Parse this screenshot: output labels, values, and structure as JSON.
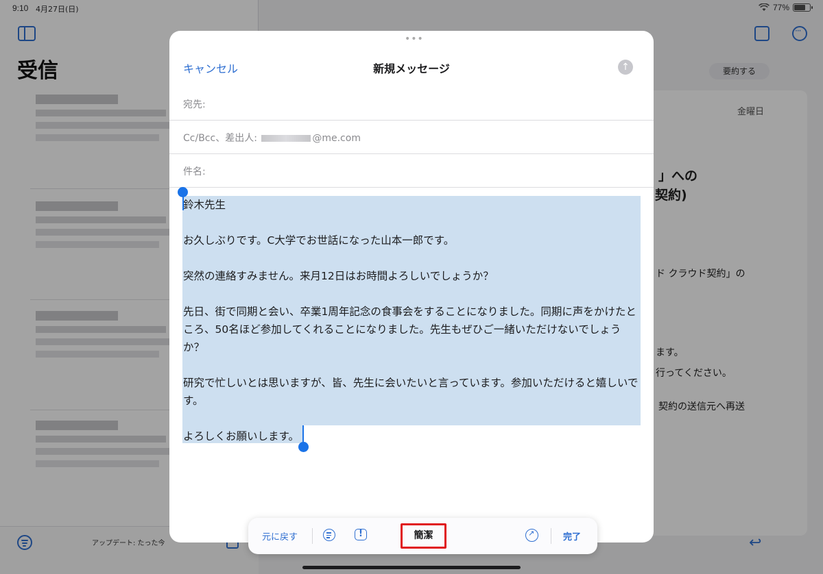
{
  "status_bar": {
    "time": "9:10",
    "date": "4月27日(日)",
    "battery": "77%",
    "battery_level": 0.77
  },
  "inbox": {
    "title": "受信",
    "updated": "アップデート: たった今"
  },
  "detail": {
    "summarize_label": "要約する",
    "day": "金曜日",
    "fragments": [
      "」への",
      "契約)",
      "ド クラウド契約」の",
      "ます。",
      "行ってください。",
      "契約の送信元へ再送"
    ]
  },
  "composer": {
    "cancel_label": "キャンセル",
    "title": "新規メッセージ",
    "to_label": "宛先:",
    "cc_label": "Cc/Bcc、差出人:",
    "from_domain": "@me.com",
    "subject_label": "件名:",
    "body": [
      "鈴木先生",
      "",
      "お久しぶりです。C大学でお世話になった山本一郎です。",
      "",
      "突然の連絡すみません。来月12日はお時間よろしいでしょうか？",
      "",
      "先日、街で同期と会い、卒業1周年記念の食事会をすることになりました。同期に声をかけたところ、50名ほど参加してくれることになりました。先生もぜひご一緒いただけないでしょうか？",
      "",
      "研究で忙しいとは思いますが、皆、先生に会いたいと言っています。参加いただけると嬉しいです。",
      "",
      "よろしくお願いします。"
    ]
  },
  "writing_tools": {
    "undo_label": "元に戻す",
    "concise_label": "簡潔",
    "done_label": "完了",
    "highlight_color": "#e0161b"
  },
  "colors": {
    "accent": "#2f6fd1",
    "selection": "#cddff0",
    "dim_overlay": "rgba(0,0,0,0.36)"
  }
}
